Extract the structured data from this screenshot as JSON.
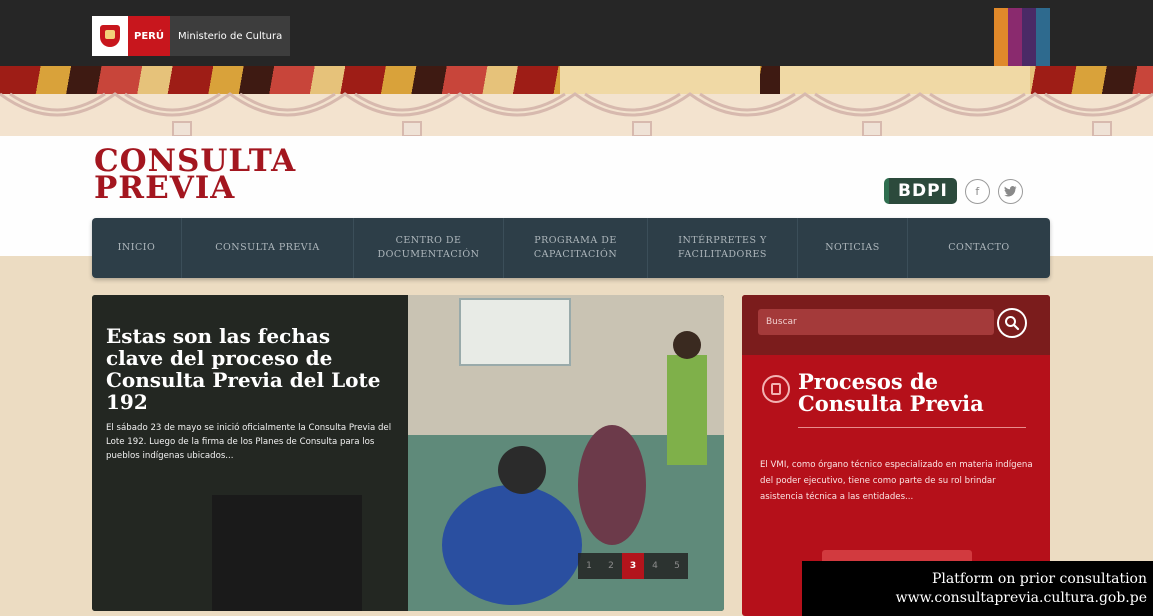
{
  "gov_bar": {
    "country_label": "PERÚ",
    "ministry_label": "Ministerio de Cultura",
    "color_bars": [
      "#e0892a",
      "#8a2a6e",
      "#4a2a66",
      "#2e6a8e"
    ]
  },
  "header": {
    "logo_line1": "CONSULTA",
    "logo_line2": "PREVIA",
    "bdpi_label": "BDPI",
    "facebook_glyph": "f",
    "twitter_glyph": "t"
  },
  "nav": {
    "items": [
      {
        "line1": "INICIO",
        "line2": ""
      },
      {
        "line1": "CONSULTA PREVIA",
        "line2": ""
      },
      {
        "line1": "CENTRO DE",
        "line2": "DOCUMENTACIÓN"
      },
      {
        "line1": "PROGRAMA DE",
        "line2": "CAPACITACIÓN"
      },
      {
        "line1": "INTÉRPRETES Y",
        "line2": "FACILITADORES"
      },
      {
        "line1": "NOTICIAS",
        "line2": ""
      },
      {
        "line1": "CONTACTO",
        "line2": ""
      }
    ]
  },
  "hero": {
    "title": "Estas son las fechas clave del proceso de Consulta Previa del Lote 192",
    "excerpt": "El sábado 23 de mayo se inició oficialmente la Consulta Previa del Lote 192. Luego de la firma de los Planes de Consulta para los pueblos indígenas ubicados...",
    "pager": [
      "1",
      "2",
      "3",
      "4",
      "5"
    ],
    "active_page": "3"
  },
  "panel": {
    "search_placeholder": "Buscar",
    "title_line1": "Procesos de",
    "title_line2": "Consulta Previa",
    "text": "El VMI, como órgano técnico especializado en materia indígena del poder ejecutivo, tiene como parte de su rol brindar asistencia técnica a las entidades..."
  },
  "credit": {
    "line1": "Platform on prior consultation",
    "line2": "www.consultaprevia.cultura.gob.pe"
  },
  "colors": {
    "brand_red": "#a3161f",
    "nav_bg": "#2d3e48",
    "panel_red": "#b5101a",
    "page_bg": "#ecdcc2"
  }
}
